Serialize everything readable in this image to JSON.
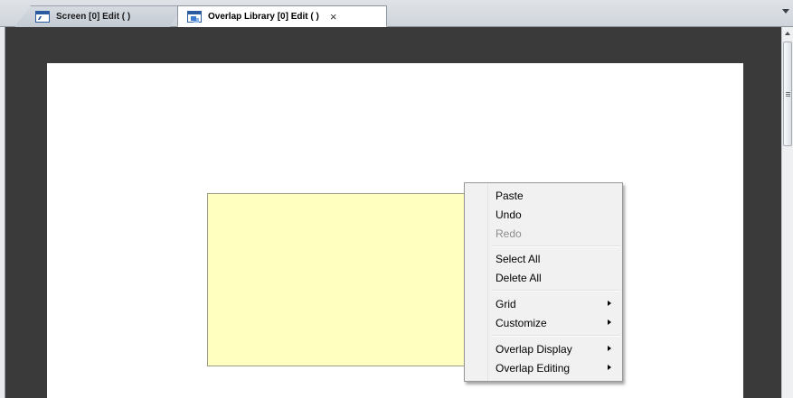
{
  "tabs": [
    {
      "label": "Screen [0] Edit (          )",
      "icon": "screen-icon",
      "active": false
    },
    {
      "label": "Overlap Library [0] Edit (          )",
      "icon": "overlap-library-icon",
      "active": true,
      "close_symbol": "×"
    }
  ],
  "context_menu": {
    "items": [
      {
        "label": "Paste",
        "enabled": true,
        "has_submenu": false
      },
      {
        "label": "Undo",
        "enabled": true,
        "has_submenu": false
      },
      {
        "label": "Redo",
        "enabled": false,
        "has_submenu": false
      },
      {
        "label": "Select All",
        "enabled": true,
        "has_submenu": false
      },
      {
        "label": "Delete All",
        "enabled": true,
        "has_submenu": false
      },
      {
        "label": "Grid",
        "enabled": true,
        "has_submenu": true
      },
      {
        "label": "Customize",
        "enabled": true,
        "has_submenu": true
      },
      {
        "label": "Overlap Display",
        "enabled": true,
        "has_submenu": true
      },
      {
        "label": "Overlap Editing",
        "enabled": true,
        "has_submenu": true
      }
    ]
  },
  "colors": {
    "workspace_background": "#3a3a3a",
    "canvas_background": "#ffffff",
    "selected_object_fill": "#ffffc0",
    "menu_background": "#f1f1f1",
    "disabled_text": "#8d8d8d"
  }
}
